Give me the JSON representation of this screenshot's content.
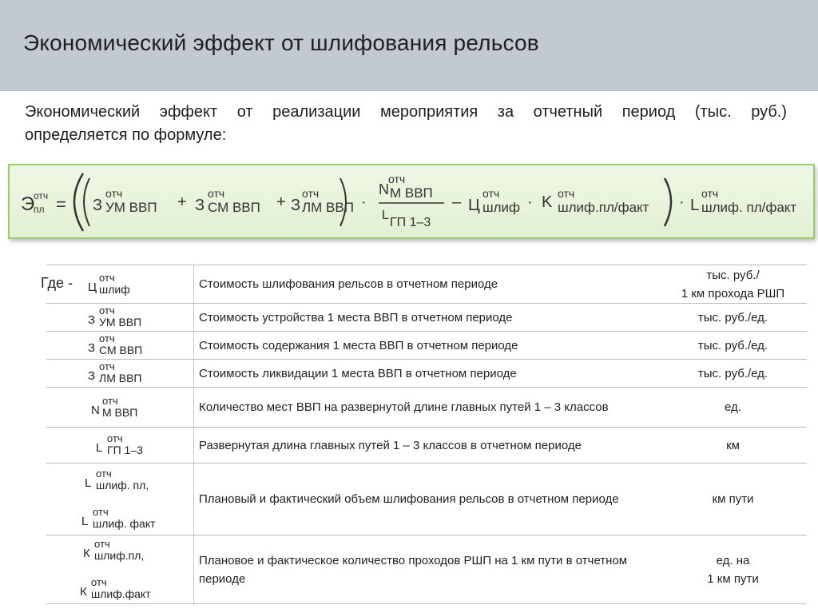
{
  "title": "Экономический эффект от шлифования рельсов",
  "intro": {
    "line1": "Экономический эффект от реализации мероприятия за отчетный период (тыс. руб.)",
    "line2": "определяется по формуле:"
  },
  "formula": {
    "E": "Э",
    "E_sup": "отч",
    "E_sub": "пл",
    "eq": "=",
    "z1": "З",
    "z1_sup": "отч",
    "z1_sub": "УМ ВВП",
    "plus1": "+",
    "z2": "З",
    "z2_sup": "отч",
    "z2_sub": "СМ ВВП",
    "plus2": "+",
    "z3": "З",
    "z3_sup": "отч",
    "z3_sub": "ЛМ ВВП",
    "dot1": "·",
    "n": "N",
    "n_sup": "отч",
    "n_sub": "М ВВП",
    "l": "L",
    "l_sup": "отч",
    "l_sub": "ГП 1–3",
    "minus": "–",
    "c": "Ц",
    "c_sup": "отч",
    "c_sub": "шлиф",
    "dot2": "·",
    "k": "K",
    "k_sup": "отч",
    "k_sub": "шлиф.пл/факт",
    "dot3": "·",
    "l2": "L",
    "l2_sup": "отч",
    "l2_sub": "шлиф. пл/факт"
  },
  "where_label": "Где -",
  "rows": [
    {
      "sym": "Ц",
      "sup": "отч",
      "sub": "шлиф",
      "desc": "Стоимость шлифования рельсов в отчетном периоде",
      "unit1": "тыс. руб./",
      "unit2": "1 км прохода РШП"
    },
    {
      "sym": "З",
      "sup": "отч",
      "sub": "УМ ВВП",
      "desc": "Стоимость устройства 1 места ВВП в отчетном периоде",
      "unit1": "тыс. руб./ед.",
      "unit2": ""
    },
    {
      "sym": "З",
      "sup": "отч",
      "sub": "СМ ВВП",
      "desc": "Стоимость содержания 1 места ВВП в отчетном периоде",
      "unit1": "тыс. руб./ед.",
      "unit2": ""
    },
    {
      "sym": "З",
      "sup": "отч",
      "sub": "ЛМ ВВП",
      "desc": "Стоимость ликвидации 1 места ВВП в отчетном периоде",
      "unit1": "тыс. руб./ед.",
      "unit2": ""
    },
    {
      "sym": "N",
      "sup": "отч",
      "sub": "М ВВП",
      "desc": "Количество мест ВВП на развернутой длине главных путей 1 – 3 классов",
      "unit1": "ед.",
      "unit2": ""
    },
    {
      "sym": "L",
      "sup": "отч",
      "sub": "ГП 1–3",
      "desc": "Развернутая длина главных путей 1 – 3 классов в отчетном периоде",
      "unit1": "км",
      "unit2": ""
    },
    {
      "sym": "L",
      "sup": "отч",
      "sub": "шлиф. пл,",
      "sym2": "L",
      "sup2": "отч",
      "sub2": "шлиф. факт",
      "desc": "Плановый и фактический объем шлифования рельсов в отчетном периоде",
      "unit1": "км пути",
      "unit2": ""
    },
    {
      "sym": "К",
      "sup": "отч",
      "sub": "шлиф.пл,",
      "sym2": "К",
      "sup2": "отч",
      "sub2": "шлиф.факт",
      "desc": "Плановое и фактическое количество проходов РШП на 1 км пути в отчетном периоде",
      "unit1": "ед. на",
      "unit2": "1 км пути"
    }
  ]
}
